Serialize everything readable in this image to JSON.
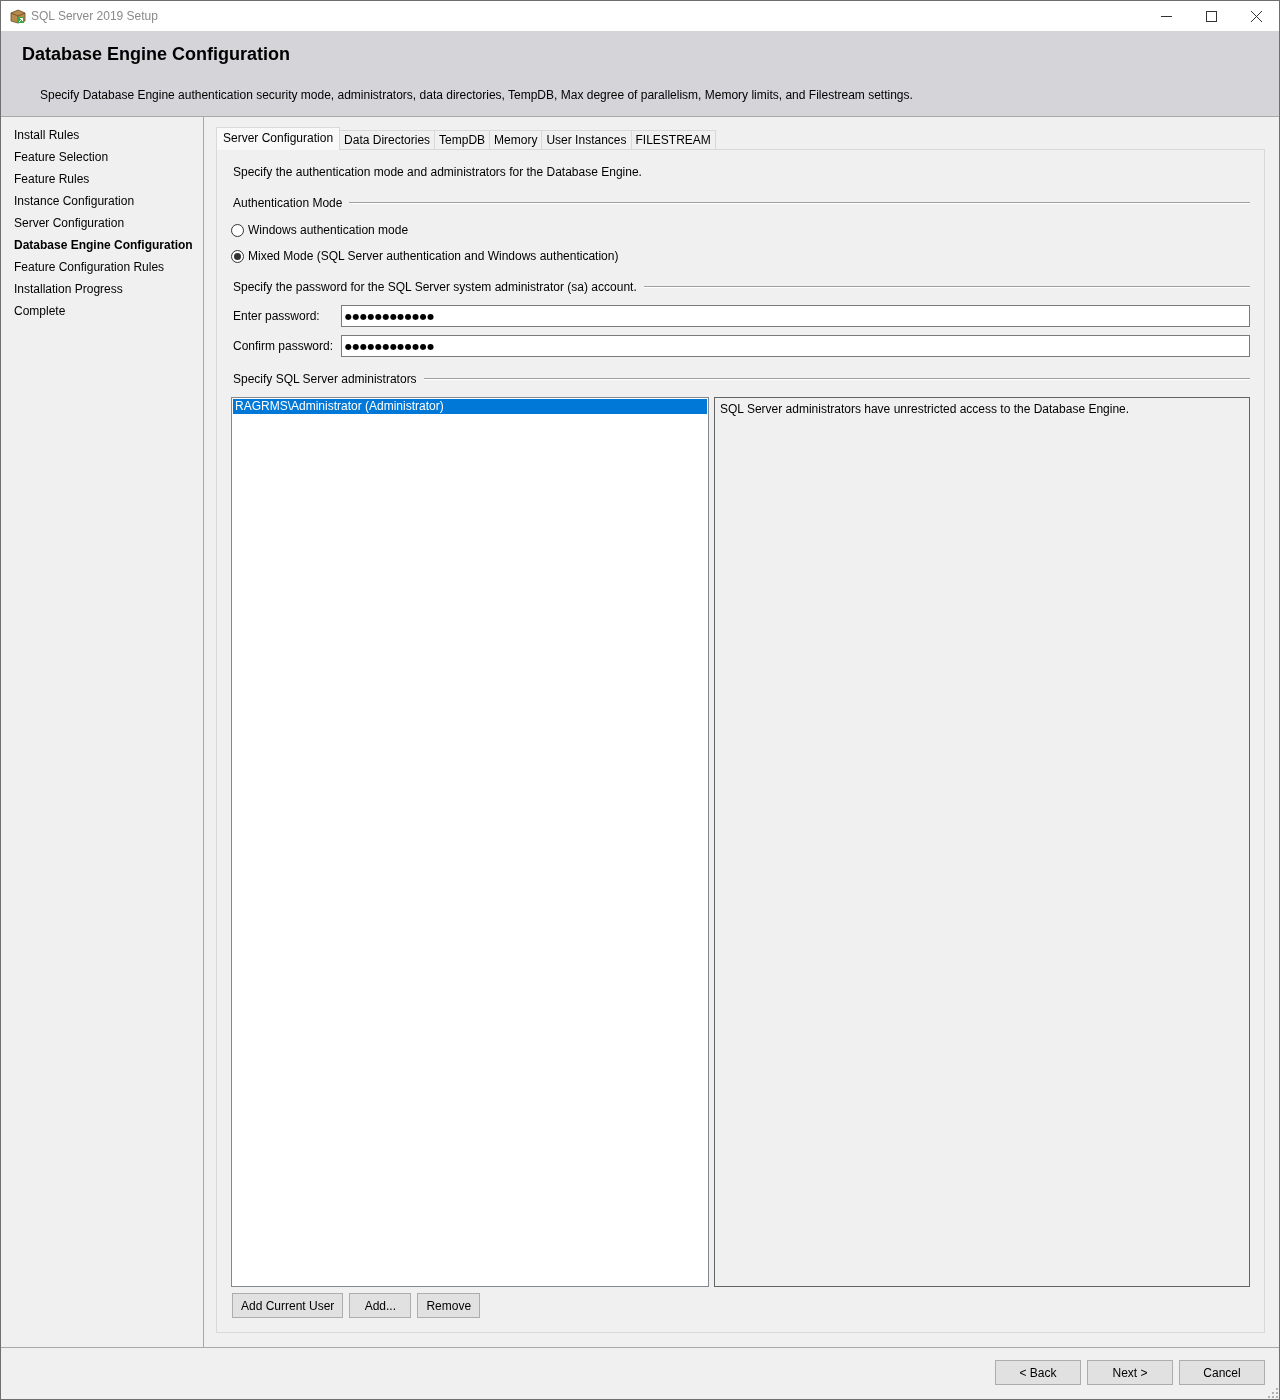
{
  "window": {
    "title": "SQL Server 2019 Setup"
  },
  "header": {
    "title": "Database Engine Configuration",
    "description": "Specify Database Engine authentication security mode, administrators, data directories, TempDB, Max degree of parallelism, Memory limits, and Filestream settings."
  },
  "sidebar": {
    "items": [
      {
        "label": "Install Rules",
        "selected": false
      },
      {
        "label": "Feature Selection",
        "selected": false
      },
      {
        "label": "Feature Rules",
        "selected": false
      },
      {
        "label": "Instance Configuration",
        "selected": false
      },
      {
        "label": "Server Configuration",
        "selected": false
      },
      {
        "label": "Database Engine Configuration",
        "selected": true
      },
      {
        "label": "Feature Configuration Rules",
        "selected": false
      },
      {
        "label": "Installation Progress",
        "selected": false
      },
      {
        "label": "Complete",
        "selected": false
      }
    ]
  },
  "tabs": [
    {
      "label": "Server Configuration",
      "selected": true
    },
    {
      "label": "Data Directories",
      "selected": false
    },
    {
      "label": "TempDB",
      "selected": false
    },
    {
      "label": "Memory",
      "selected": false
    },
    {
      "label": "User Instances",
      "selected": false
    },
    {
      "label": "FILESTREAM",
      "selected": false
    }
  ],
  "server_configuration": {
    "intro": "Specify the authentication mode and administrators for the Database Engine.",
    "authentication_mode": {
      "title": "Authentication Mode",
      "options": [
        {
          "label": "Windows authentication mode",
          "selected": false
        },
        {
          "label": "Mixed Mode (SQL Server authentication and Windows authentication)",
          "selected": true
        }
      ]
    },
    "password": {
      "title": "Specify the password for the SQL Server system administrator (sa) account.",
      "fields": [
        {
          "label": "Enter password:",
          "value": "●●●●●●●●●●●●"
        },
        {
          "label": "Confirm password:",
          "value": "●●●●●●●●●●●●"
        }
      ]
    },
    "administrators": {
      "title": "Specify SQL Server administrators",
      "list": [
        {
          "label": "RAGRMS\\Administrator (Administrator)",
          "selected": true
        }
      ],
      "description": "SQL Server administrators have unrestricted access to the Database Engine.",
      "buttons": [
        "Add Current User",
        "Add...",
        "Remove"
      ]
    }
  },
  "footer": {
    "buttons": [
      "< Back",
      "Next >",
      "Cancel"
    ]
  }
}
